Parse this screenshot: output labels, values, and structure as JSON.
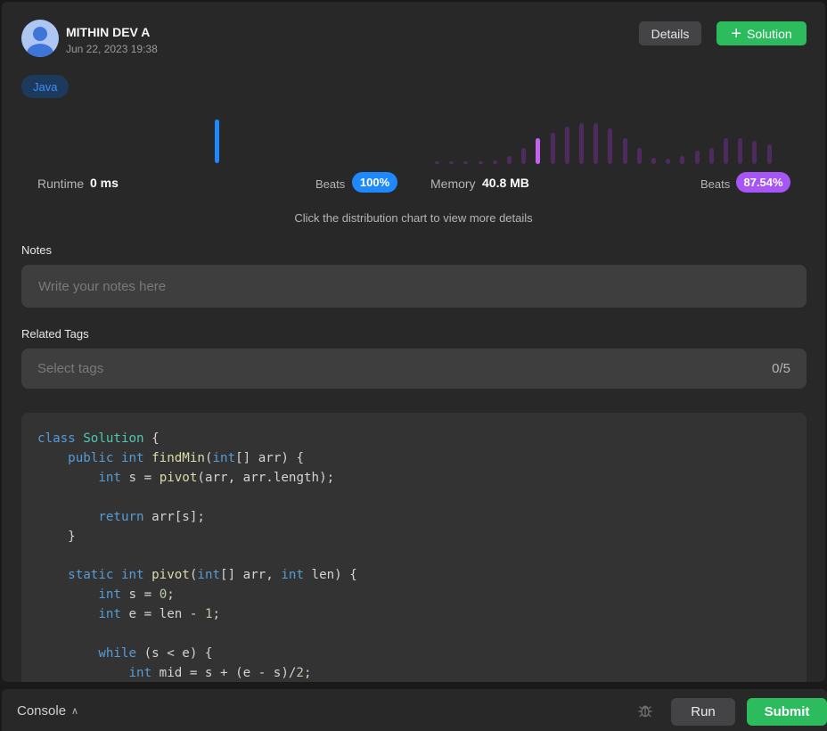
{
  "submission": {
    "user_name": "MITHIN DEV A",
    "timestamp": "Jun 22, 2023 19:38",
    "language": "Java",
    "details_label": "Details",
    "solution_label": "Solution"
  },
  "runtime": {
    "label": "Runtime",
    "value": "0 ms",
    "beats_label": "Beats",
    "beats_percent": "100%",
    "color": "#1e88ff"
  },
  "memory": {
    "label": "Memory",
    "value": "40.8 MB",
    "beats_label": "Beats",
    "beats_percent": "87.54%",
    "highlight_color": "#c362f0",
    "bar_color": "#4e2b5e",
    "distribution": [
      1,
      1,
      1,
      1,
      2,
      5,
      10,
      16,
      19,
      23,
      25,
      25,
      22,
      16,
      10,
      4,
      3,
      5,
      8,
      10,
      16,
      16,
      14,
      12
    ],
    "selected_index": 7
  },
  "hint": "Click the distribution chart to view more details",
  "notes": {
    "label": "Notes",
    "placeholder": "Write your notes here"
  },
  "tags": {
    "label": "Related Tags",
    "placeholder": "Select tags",
    "count": "0/5"
  },
  "footer": {
    "console_label": "Console",
    "run_label": "Run",
    "submit_label": "Submit"
  }
}
